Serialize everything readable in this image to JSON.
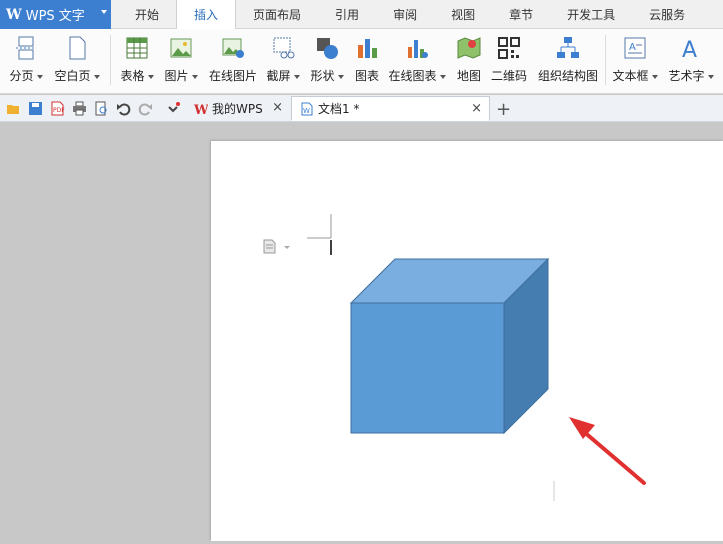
{
  "app": {
    "title": "WPS 文字",
    "logo_letter": "W"
  },
  "menu_tabs": [
    "开始",
    "插入",
    "页面布局",
    "引用",
    "审阅",
    "视图",
    "章节",
    "开发工具",
    "云服务"
  ],
  "active_tab": "插入",
  "ribbon": {
    "page_break": "分页",
    "blank_page": "空白页",
    "table": "表格",
    "picture": "图片",
    "online_picture": "在线图片",
    "screenshot": "截屏",
    "shapes": "形状",
    "chart": "图表",
    "online_chart": "在线图表",
    "map": "地图",
    "qrcode": "二维码",
    "org_chart": "组织结构图",
    "textbox": "文本框",
    "wordart": "艺术字"
  },
  "doc_tabs": {
    "my_wps": "我的WPS",
    "doc1": "文档1 *"
  },
  "colors": {
    "accent": "#3c7fd0",
    "cube_front": "#5b9bd5",
    "cube_top": "#7aaee0",
    "cube_side": "#467db1",
    "arrow": "#e03030"
  }
}
